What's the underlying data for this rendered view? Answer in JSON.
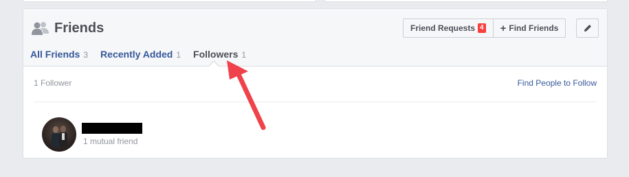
{
  "header": {
    "title": "Friends",
    "friend_requests_label": "Friend Requests",
    "friend_requests_count": "4",
    "find_friends_label": "Find Friends",
    "plus_glyph": "+"
  },
  "tabs": [
    {
      "label": "All Friends",
      "count": "3"
    },
    {
      "label": "Recently Added",
      "count": "1"
    },
    {
      "label": "Followers",
      "count": "1"
    }
  ],
  "content": {
    "follower_count_text": "1 Follower",
    "find_people_label": "Find People to Follow"
  },
  "followers": [
    {
      "mutual_text": "1 mutual friend"
    }
  ],
  "annotation": {
    "arrow_color": "#f0424b"
  },
  "colors": {
    "link": "#365899",
    "badge": "#fa3e3e",
    "muted": "#90949c"
  }
}
